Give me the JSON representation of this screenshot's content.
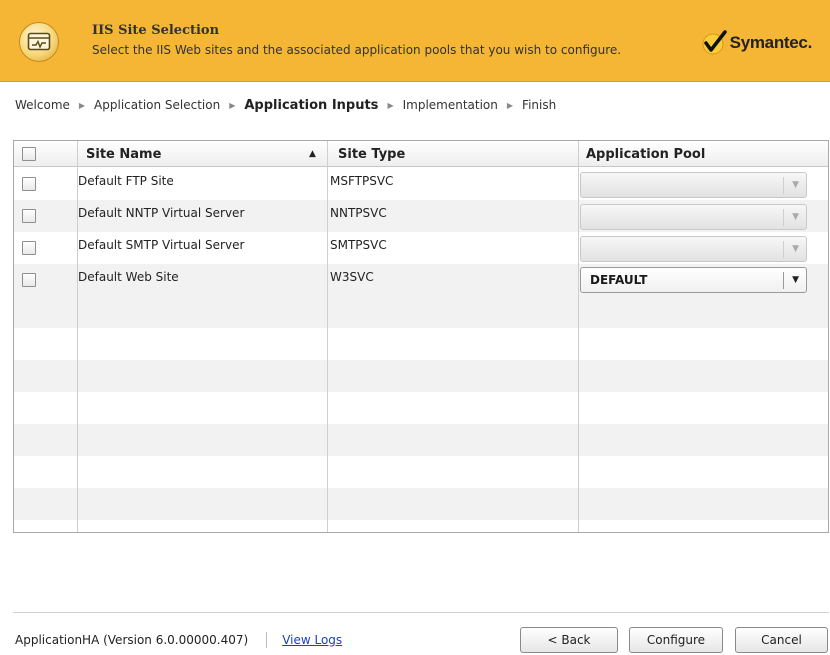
{
  "header": {
    "title": "IIS Site Selection",
    "subtitle": "Select the IIS Web sites and the associated application pools that you wish to configure.",
    "brand": "Symantec.",
    "brand_color": "#f5b535"
  },
  "breadcrumb": [
    {
      "label": "Welcome",
      "active": false
    },
    {
      "label": "Application Selection",
      "active": false
    },
    {
      "label": "Application Inputs",
      "active": true
    },
    {
      "label": "Implementation",
      "active": false
    },
    {
      "label": "Finish",
      "active": false
    }
  ],
  "table": {
    "columns": [
      "Site Name",
      "Site Type",
      "Application Pool"
    ],
    "sort": {
      "column": "Site Name",
      "direction": "ascending"
    },
    "rows": [
      {
        "site_name": "Default FTP Site",
        "site_type": "MSFTPSVC",
        "app_pool": "",
        "pool_enabled": false,
        "checked": false
      },
      {
        "site_name": "Default NNTP Virtual Server",
        "site_type": "NNTPSVC",
        "app_pool": "",
        "pool_enabled": false,
        "checked": false
      },
      {
        "site_name": "Default SMTP Virtual Server",
        "site_type": "SMTPSVC",
        "app_pool": "",
        "pool_enabled": false,
        "checked": false
      },
      {
        "site_name": "Default Web Site",
        "site_type": "W3SVC",
        "app_pool": "DEFAULT",
        "pool_enabled": true,
        "checked": false
      }
    ]
  },
  "footer": {
    "version": "ApplicationHA (Version 6.0.00000.407)",
    "view_logs": "View Logs",
    "back": "< Back",
    "configure": "Configure",
    "cancel": "Cancel"
  },
  "icons": {
    "header": "console-window-icon",
    "brand": "checkmark-logo-icon",
    "breadcrumb_separator": "triangle-right-icon",
    "sort": "sort-ascending-icon",
    "dropdown": "chevron-down-icon"
  }
}
